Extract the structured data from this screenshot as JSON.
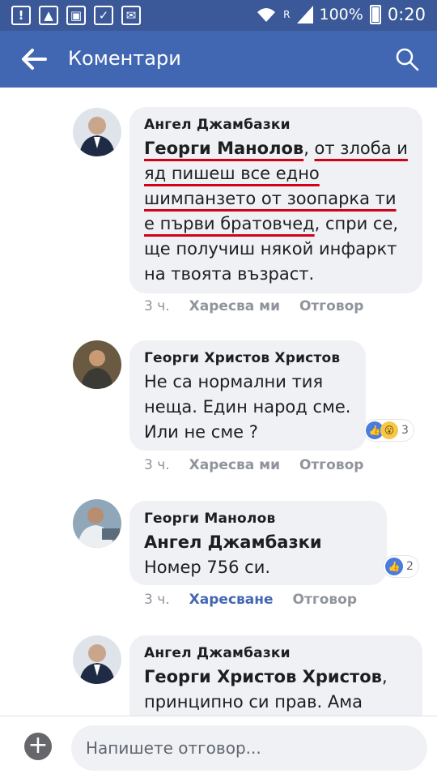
{
  "status_bar": {
    "battery": "100%",
    "time": "0:20",
    "network": "R"
  },
  "header": {
    "title": "Коментари"
  },
  "comments": [
    {
      "author": "Ангел Джамбазки",
      "mention": "Георги Манолов",
      "text_parts": [
        ", ",
        "от злоба и яд пишеш все едно шимпанзето от зоопарка ти е първи братовчед",
        ", спри се, ще получиш някой инфаркт на твоята възраст."
      ],
      "time": "3 ч.",
      "like": "Харесва ми",
      "reply": "Отговор"
    },
    {
      "author": "Георги Христов Христов",
      "text": "Не са нормални тия неща. Един народ сме. Или не сме ?",
      "reaction_count": "3",
      "time": "3 ч.",
      "like": "Харесва ми",
      "reply": "Отговор"
    },
    {
      "author": "Георги Манолов",
      "mention": "Ангел Джамбазки",
      "text": "Номер 756 си.",
      "reaction_count": "2",
      "time": "3 ч.",
      "like": "Харесване",
      "reply": "Отговор"
    },
    {
      "author": "Ангел Джамбазки",
      "mention": "Георги Христов Христов",
      "text": ", принципно си прав. Ама"
    }
  ],
  "input": {
    "placeholder": "Напишете отговор..."
  },
  "colors": {
    "header": "#4267b2",
    "status_bar": "#3b5998",
    "bubble": "#f0f1f4",
    "underline": "#d0021b",
    "liked": "#4267b2"
  }
}
